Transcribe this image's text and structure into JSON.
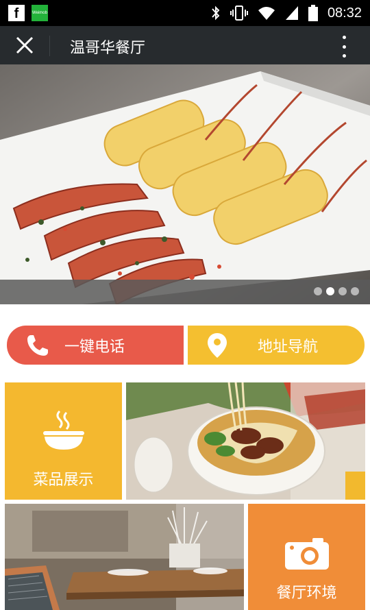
{
  "status_bar": {
    "time": "08:32",
    "facebook_icon": "facebook-icon",
    "weimob_label": "Weimob"
  },
  "app_bar": {
    "title": "温哥华餐厅"
  },
  "banner": {
    "slide_count": 4,
    "active_slide": 2
  },
  "actions": {
    "call_label": "一键电话",
    "nav_label": "地址导航"
  },
  "tiles": {
    "menu_label": "菜品展示",
    "env_label": "餐厅环境"
  },
  "colors": {
    "call": "#e85a4a",
    "nav": "#f4bf30",
    "menu_tile": "#f4b82f",
    "env_tile": "#f08d38",
    "app_bar": "#272b2e"
  }
}
